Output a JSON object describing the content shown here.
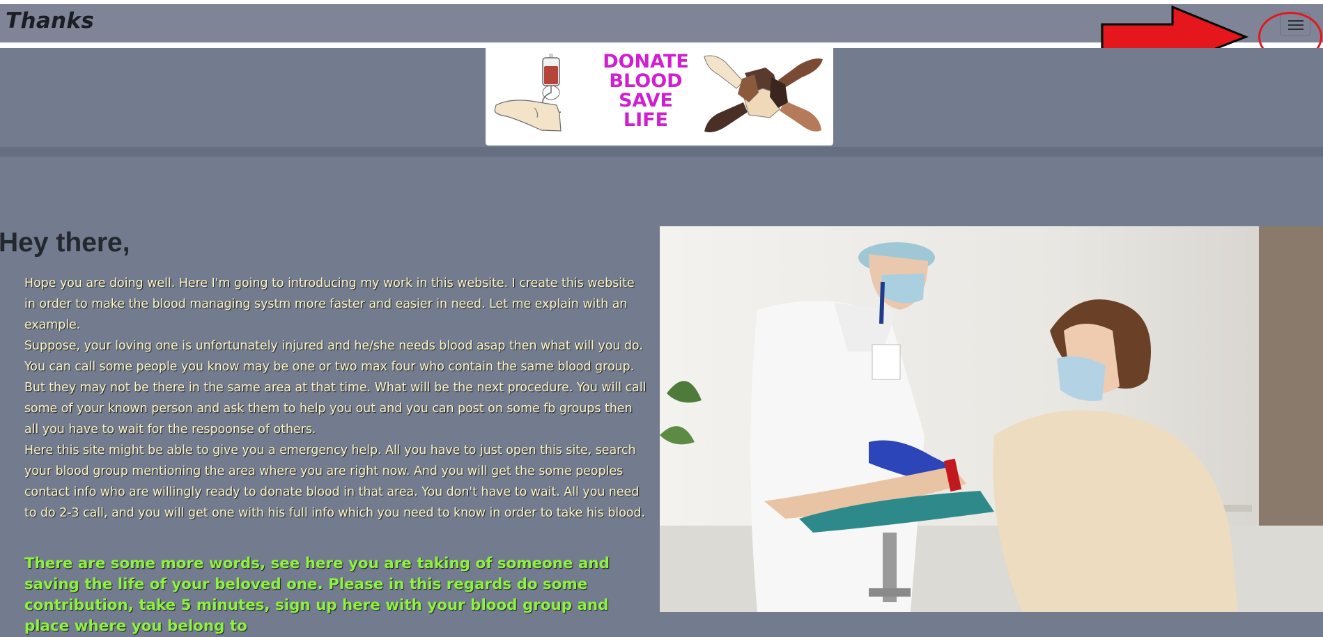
{
  "navbar": {
    "brand": "Thanks"
  },
  "banner": {
    "line1": "DONATE",
    "line2": "BLOOD",
    "line3": "SAVE",
    "line4": "LIFE"
  },
  "main": {
    "heading": "Hey there,",
    "paragraphs": [
      "Hope you are doing well. Here I'm going to introducing my work in this website. I create this website in order to make the blood managing systm more faster and easier in need. Let me explain with an example.",
      "Suppose, your loving one is unfortunately injured and he/she needs blood asap then what will you do. You can call some people you know may be one or two max four who contain the same blood group. But they may not be there in the same area at that time. What will be the next procedure. You will call some of your known person and ask them to help you out and you can post on some fb groups then all you have to wait for the respoonse of others.",
      "Here this site might be able to give you a emergency help. All you have to just open this site, search your blood group mentioning the area where you are right now. And you will get the some peoples contact info who are willingly ready to donate blood in that area. You don't have to wait. All you need to do 2-3 call, and you will get one with his full info which you need to know in order to take his blood."
    ],
    "highlight": "There are some more words, see here you are taking of someone and saving the life of your beloved one. Please in this regards do some contribution, take 5 minutes, sign up here with your blood group and place where you belong to"
  },
  "colors": {
    "navbar": "#7f8496",
    "page_background": "#737c8f",
    "banner_text": "#cf1fd0",
    "paragraph_text": "#fdf6c6",
    "highlight_text": "#8ef240",
    "annotation": "#e2161e"
  },
  "icons": {
    "menu": "hamburger-menu-icon",
    "annotation_arrow": "arrow-right-icon"
  }
}
